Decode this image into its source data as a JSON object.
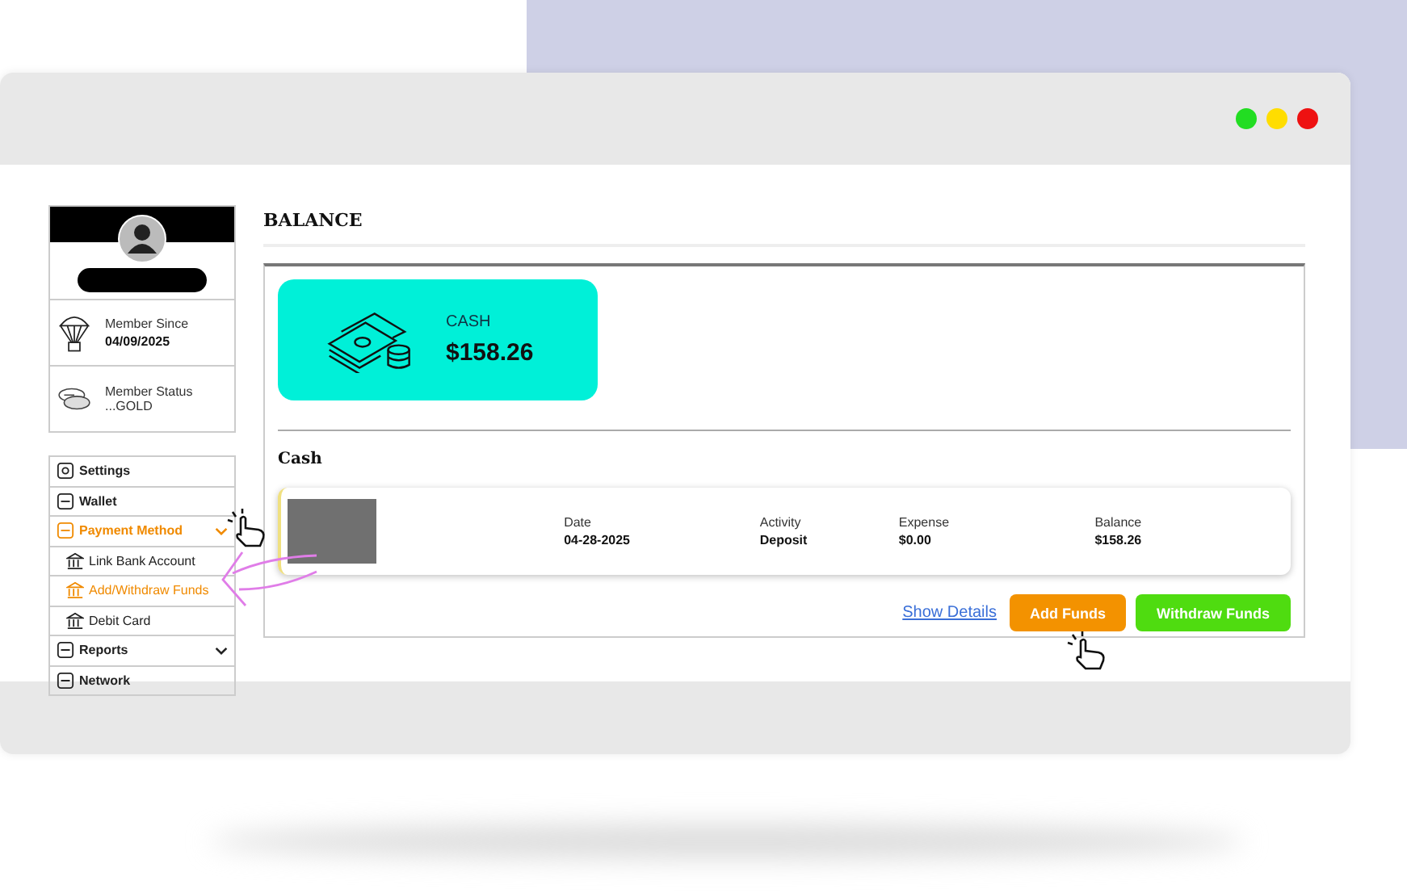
{
  "window": {
    "controls": [
      {
        "color": "#22dd22"
      },
      {
        "color": "#ffdd00"
      },
      {
        "color": "#ee1111"
      }
    ]
  },
  "profile": {
    "member_since": {
      "label": "Member Since",
      "value": "04/09/2025"
    },
    "member_status": {
      "label": "Member Status",
      "value": "...GOLD"
    }
  },
  "sidebar": {
    "items": [
      {
        "label": "Settings",
        "selected": false
      },
      {
        "label": "Wallet",
        "selected": false
      },
      {
        "label": "Payment Method",
        "selected": true,
        "expanded": true,
        "children": [
          {
            "label": "Link Bank Account",
            "selected": false
          },
          {
            "label": "Add/Withdraw Funds",
            "selected": true
          },
          {
            "label": "Debit Card",
            "selected": false
          }
        ]
      },
      {
        "label": "Reports",
        "selected": false,
        "expanded": false
      },
      {
        "label": "Network",
        "selected": false
      }
    ]
  },
  "balance": {
    "title": "BALANCE",
    "card": {
      "label": "CASH",
      "amount": "$158.26"
    }
  },
  "cash": {
    "title": "Cash",
    "transaction": [
      {
        "label": "Date",
        "value": "04-28-2025"
      },
      {
        "label": "Activity",
        "value": "Deposit"
      },
      {
        "label": "Expense",
        "value": "$0.00"
      },
      {
        "label": "Balance",
        "value": "$158.26"
      }
    ],
    "link": "Show Details",
    "buttons": [
      {
        "label": "Add Funds",
        "kind": "add"
      },
      {
        "label": "Withdraw Funds",
        "kind": "withdraw"
      }
    ]
  }
}
